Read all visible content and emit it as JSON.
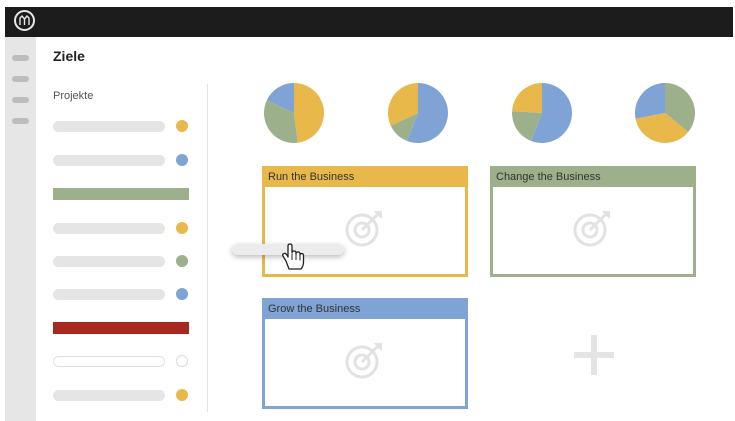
{
  "header": {
    "logo_icon": "monogram-logo-icon"
  },
  "rail": {
    "items": 4
  },
  "page": {
    "title": "Ziele"
  },
  "projects": {
    "heading": "Projekte",
    "items": [
      {
        "type": "bar",
        "dot": "#e8b84a"
      },
      {
        "type": "bar",
        "dot": "#7fa3d4"
      },
      {
        "type": "block",
        "color": "#9db08c"
      },
      {
        "type": "bar",
        "dot": "#e8b84a"
      },
      {
        "type": "bar",
        "dot": "#9db08c"
      },
      {
        "type": "bar",
        "dot": "#7fa3d4"
      },
      {
        "type": "block",
        "color": "#a8291f"
      },
      {
        "type": "outline"
      },
      {
        "type": "bar",
        "dot": "#e8b84a"
      }
    ]
  },
  "colors": {
    "yellow": "#e8b84a",
    "green": "#9db08c",
    "blue": "#7fa3d4",
    "red": "#a8291f"
  },
  "pies": [
    {
      "slices": [
        {
          "value": 0.48,
          "color": "#e8b84a"
        },
        {
          "value": 0.34,
          "color": "#9db08c"
        },
        {
          "value": 0.18,
          "color": "#7fa3d4"
        }
      ]
    },
    {
      "slices": [
        {
          "value": 0.56,
          "color": "#7fa3d4"
        },
        {
          "value": 0.12,
          "color": "#9db08c"
        },
        {
          "value": 0.32,
          "color": "#e8b84a"
        }
      ]
    },
    {
      "slices": [
        {
          "value": 0.56,
          "color": "#7fa3d4"
        },
        {
          "value": 0.2,
          "color": "#9db08c"
        },
        {
          "value": 0.24,
          "color": "#e8b84a"
        }
      ]
    },
    {
      "slices": [
        {
          "value": 0.36,
          "color": "#9db08c"
        },
        {
          "value": 0.36,
          "color": "#e8b84a"
        },
        {
          "value": 0.28,
          "color": "#7fa3d4"
        }
      ]
    }
  ],
  "cards": [
    {
      "label": "Run the Business",
      "color": "#e8b84a",
      "icon": "target-icon"
    },
    {
      "label": "Change the Business",
      "color": "#9db08c",
      "icon": "target-icon"
    },
    {
      "label": "Grow the Business",
      "color": "#7fa3d4",
      "icon": "target-icon"
    }
  ],
  "add_button": {
    "icon": "plus-icon"
  },
  "drag": {
    "cursor_icon": "hand-cursor-icon"
  }
}
